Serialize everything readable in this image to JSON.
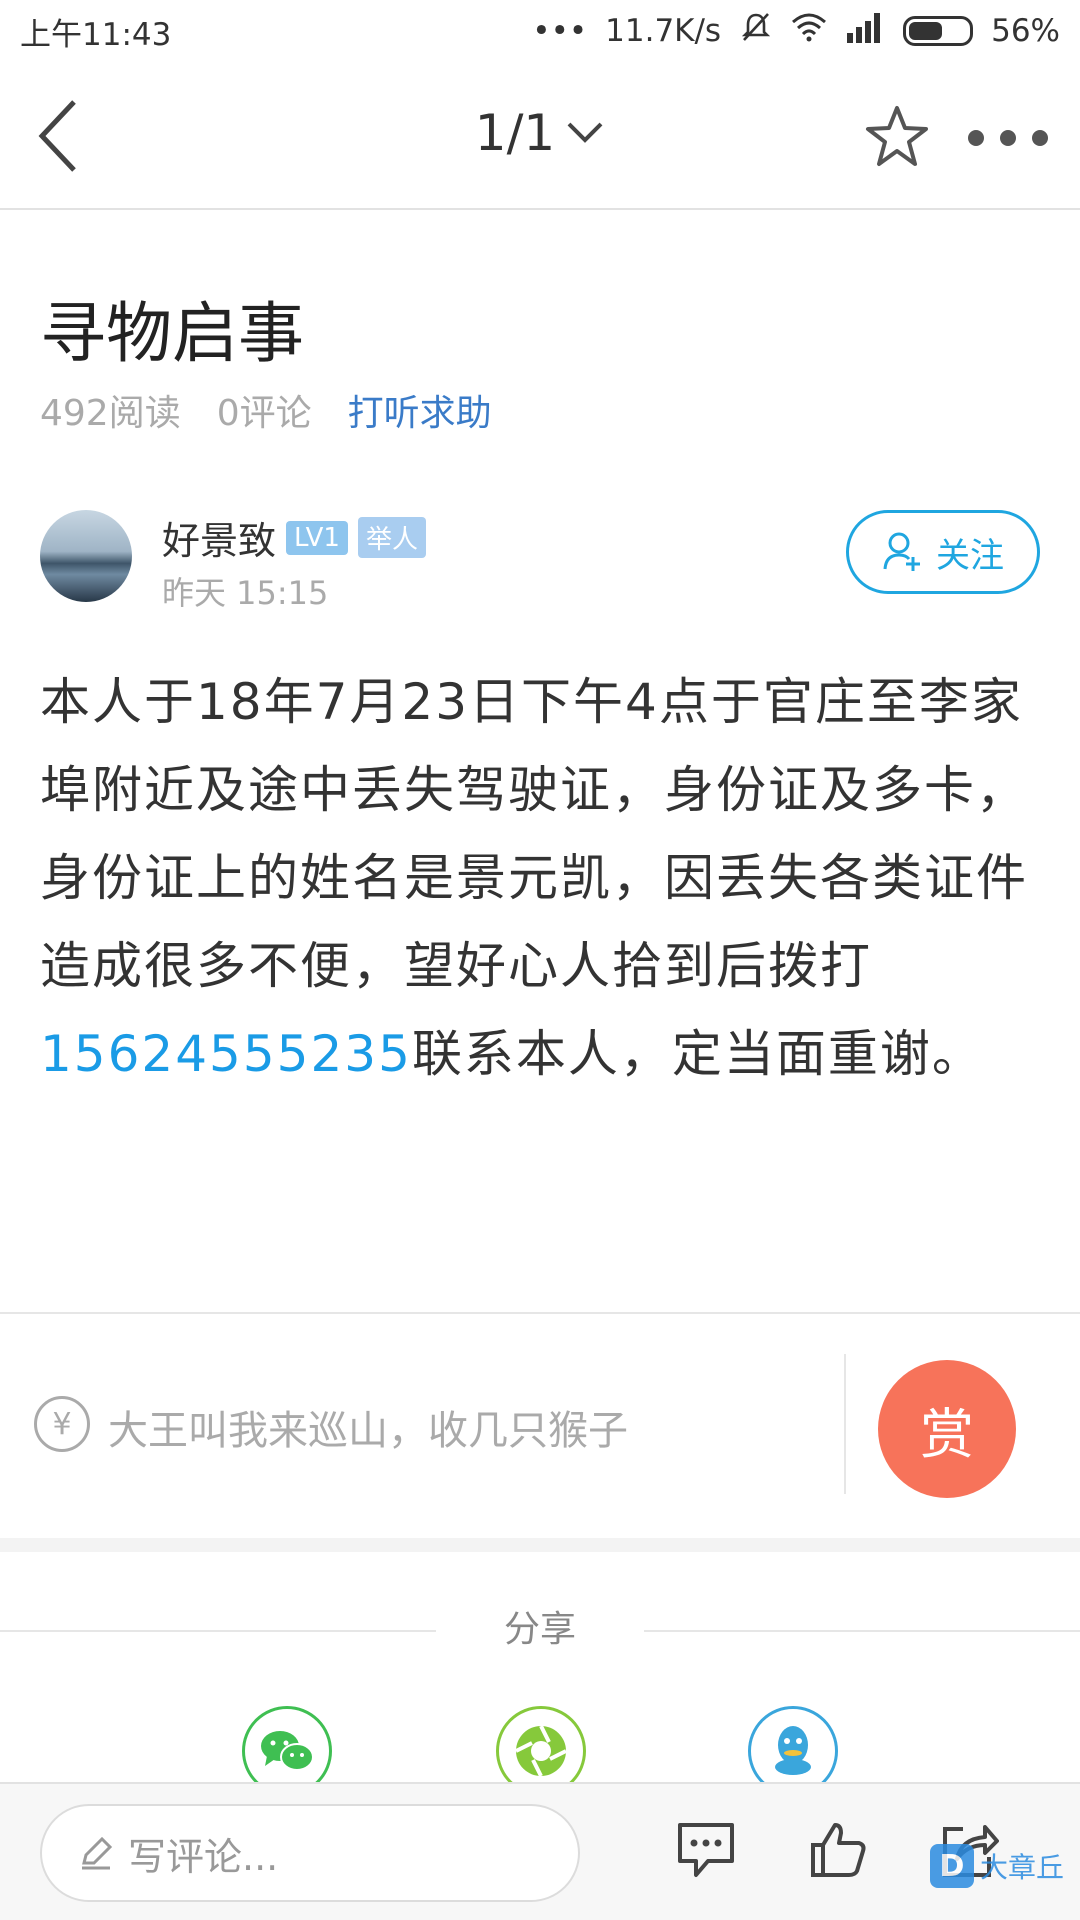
{
  "status_bar": {
    "time": "上午11:43",
    "dots": "•••",
    "network_speed": "11.7K/s",
    "battery_percent": "56%",
    "battery_level": 0.56
  },
  "nav": {
    "page_indicator": "1/1"
  },
  "article": {
    "title": "寻物启事",
    "reads": "492阅读",
    "comments": "0评论",
    "help_link": "打听求助",
    "author": {
      "name": "好景致",
      "level_badge": "LV1",
      "role_badge": "举人",
      "time": "昨天 15:15",
      "follow_label": "关注"
    },
    "body_before_phone": "本人于18年7月23日下午4点于官庄至李家埠附近及途中丢失驾驶证，身份证及多卡，身份证上的姓名是景元凯，因丢失各类证件造成很多不便，望好心人拾到后拨打",
    "phone": "15624555235",
    "body_after_phone": "联系本人，定当面重谢。"
  },
  "reward": {
    "yen_symbol": "¥",
    "prompt": "大王叫我来巡山，收几只猴子",
    "button_label": "赏"
  },
  "share": {
    "label": "分享"
  },
  "bottom_bar": {
    "comment_placeholder": "写评论...",
    "watermark_logo": "D",
    "watermark_text": "大章丘"
  },
  "colors": {
    "accent_blue": "#1a9be6",
    "reward_orange": "#f7735a",
    "wechat_green": "#3fbf52",
    "qq_blue": "#3aa6dc"
  }
}
